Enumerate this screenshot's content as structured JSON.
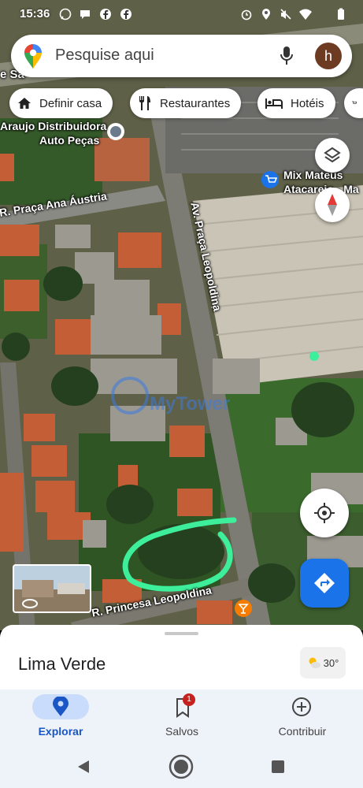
{
  "status_bar": {
    "time": "15:36",
    "icons_left": [
      "whatsapp-icon",
      "chat-icon",
      "facebook-icon",
      "facebook-icon"
    ],
    "icons_right": [
      "alarm-icon",
      "location-icon",
      "mute-icon",
      "wifi-icon",
      "battery-icon"
    ]
  },
  "search": {
    "placeholder": "Pesquise aqui",
    "avatar_initial": "h",
    "icons": [
      "maps-pin-icon",
      "mic-icon"
    ]
  },
  "chips": [
    {
      "label": "Definir casa",
      "icon": "home-icon"
    },
    {
      "label": "Restaurantes",
      "icon": "fork-knife-icon"
    },
    {
      "label": "Hotéis",
      "icon": "bed-icon"
    }
  ],
  "map": {
    "labels": {
      "poi_1_line1": "Araujo Distribuidora",
      "poi_1_line2": "Auto Peças",
      "poi_2_line1": "Mix Mateus",
      "poi_2_line2": "Atacarejo - Ma",
      "street_1": "R. Praça Ana Áustria",
      "street_2": "Av. Praça Leopoldina",
      "street_3": "R. Princesa Leopoldina",
      "street_top": "e Sa",
      "watermark": "MyTower"
    },
    "highlight_color": "#3dee9a"
  },
  "sheet": {
    "place": "Lima Verde",
    "temperature": "30°"
  },
  "nav": {
    "items": [
      {
        "label": "Explorar",
        "icon": "location-pin-icon",
        "active": true
      },
      {
        "label": "Salvos",
        "icon": "bookmark-icon",
        "badge": "1"
      },
      {
        "label": "Contribuir",
        "icon": "add-circle-icon"
      }
    ]
  },
  "colors": {
    "accent": "#1a73e8",
    "nav_active": "#1a56c6",
    "badge": "#c5221f"
  }
}
